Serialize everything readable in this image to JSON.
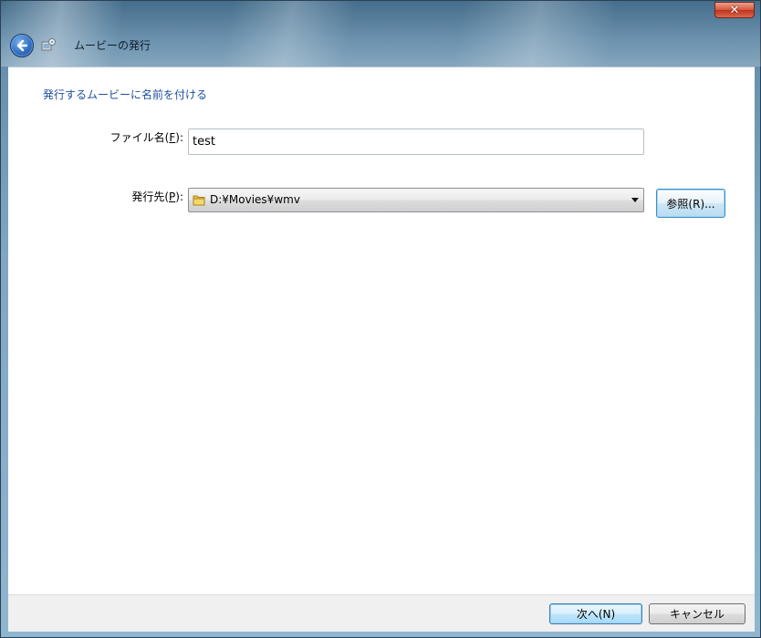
{
  "window": {
    "title": "ムービーの発行",
    "close_glyph": "✕",
    "accent_color": "#1f4fa0"
  },
  "icons": {
    "back": "back-arrow-icon",
    "app": "publish-movie-icon",
    "folder": "folder-icon",
    "dropdown": "chevron-down-icon"
  },
  "main": {
    "heading": "発行するムービーに名前を付ける",
    "filename": {
      "label_prefix": "ファイル名(",
      "label_key": "F",
      "label_suffix": "):",
      "value": "test"
    },
    "destination": {
      "label_prefix": "発行先(",
      "label_key": "P",
      "label_suffix": "):",
      "selected": "D:¥Movies¥wmv"
    },
    "browse_button": "参照(R)..."
  },
  "footer": {
    "next_button": "次へ(N)",
    "cancel_button": "キャンセル"
  }
}
